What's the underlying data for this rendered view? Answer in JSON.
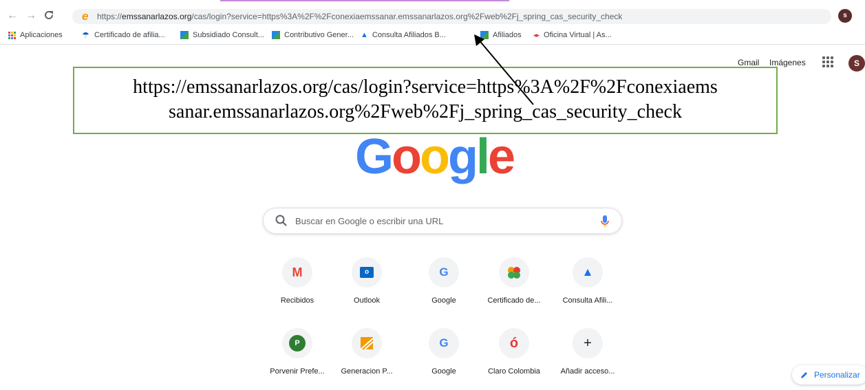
{
  "browser": {
    "url_host": "emssanarlazos.org",
    "url_prefix": "https://",
    "url_rest": "/cas/login?service=https%3A%2F%2Fconexiaemssanar.emssanarlazos.org%2Fweb%2Fj_spring_cas_security_check",
    "profile_initial": "s",
    "bookmarks": [
      "Aplicaciones",
      "Certificado de afilia...",
      "Subsidiado Consult...",
      "Contributivo Gener...",
      "Consulta Afiliados B...",
      "Afiliados",
      "Oficina Virtual | As..."
    ]
  },
  "google_bar": {
    "gmail": "Gmail",
    "images": "Imágenes",
    "avatar_initial": "S"
  },
  "annotation": {
    "line1": "https://emssanarlazos.org/cas/login?service=https%3A%2F%2Fconexiaems",
    "line2": "sanar.emssanarlazos.org%2Fweb%2Fj_spring_cas_security_check"
  },
  "logo": {
    "letters": [
      "G",
      "o",
      "o",
      "g",
      "l",
      "e"
    ],
    "colors": [
      "#4285f4",
      "#ea4335",
      "#fbbc05",
      "#4285f4",
      "#34a853",
      "#ea4335"
    ]
  },
  "search": {
    "placeholder": "Buscar en Google o escribir una URL"
  },
  "shortcuts": [
    {
      "label": "Recibidos",
      "glyph": "M",
      "color": "#ea4335"
    },
    {
      "label": "Outlook",
      "glyph": "o",
      "color": "#0a66c2"
    },
    {
      "label": "Google",
      "glyph": "G",
      "color": "#4285f4"
    },
    {
      "label": "Certificado de...",
      "glyph": "●",
      "color": "#e37400"
    },
    {
      "label": "Consulta Afili...",
      "glyph": "▲",
      "color": "#1a73e8"
    },
    {
      "label": "Porvenir Prefe...",
      "glyph": "P",
      "color": "#ffffff"
    },
    {
      "label": "Generacion P...",
      "glyph": "◤",
      "color": "#f29900"
    },
    {
      "label": "Google",
      "glyph": "G",
      "color": "#4285f4"
    },
    {
      "label": "Claro Colombia",
      "glyph": "ó",
      "color": "#e53935"
    },
    {
      "label": "Añadir acceso...",
      "glyph": "+",
      "color": "#202124"
    }
  ],
  "personalize": {
    "label": "Personalizar"
  }
}
